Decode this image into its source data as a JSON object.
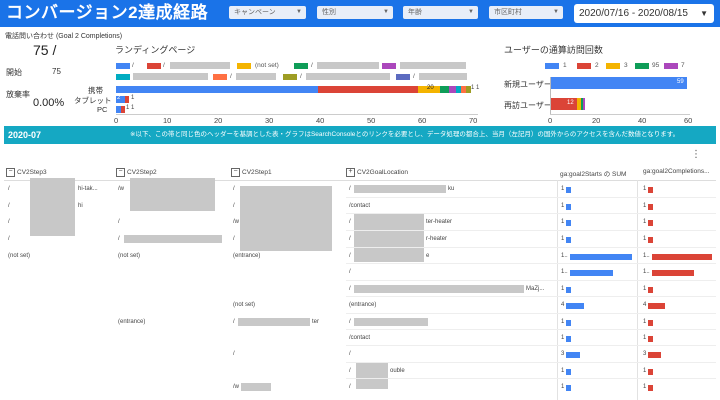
{
  "header": {
    "title": "コンバージョン2達成経路",
    "filters": [
      "キャンペーン",
      "性別",
      "年齢",
      "市区町村"
    ],
    "date_range": "2020/07/16 - 2020/08/15"
  },
  "scorecard": {
    "label": "電話問い合わせ (Goal 2 Completions)",
    "value": "75 /",
    "start_label": "開始",
    "start_value": "75",
    "abandon_label": "放棄率",
    "abandon_value": "0.00%"
  },
  "landing": {
    "title": "ランディングページ",
    "legend": [
      "/",
      "/",
      "(not set)",
      "/",
      "/",
      "/",
      "/",
      "/"
    ],
    "device_labels": [
      "携帯",
      "タブレット",
      "PC"
    ],
    "mobile_inline_labels": [
      "20",
      "1",
      "1"
    ],
    "tablet_inline_labels": [
      "2",
      "1"
    ],
    "pc_inline_labels": [
      "1",
      "1"
    ],
    "x_ticks": [
      "0",
      "10",
      "20",
      "30",
      "40",
      "50",
      "60",
      "70"
    ]
  },
  "visits": {
    "title": "ユーザーの通算訪問回数",
    "legend": [
      "1",
      "2",
      "3",
      "95",
      "7"
    ],
    "rows": [
      "新規ユーザー",
      "再訪ユーザー"
    ],
    "new_value": "59",
    "return_value": "12",
    "x_ticks": [
      "0",
      "20",
      "40",
      "60"
    ]
  },
  "banner": {
    "period": "2020-07",
    "note": "※以下、この帯と同じ色のヘッダーを基調とした表・グラフはSearchConsoleとのリンクを必要とし、データ処理の都合上、当月（左記月）の国外からのアクセスを含んだ数値となります。"
  },
  "table": {
    "headers": [
      "CV2Step3",
      "CV2Step2",
      "CV2Step1",
      "CV2GoalLocation",
      "ga:goal2Starts の SUM",
      "ga:goal2Completions..."
    ],
    "step3": [
      "/",
      "/",
      "/",
      "/",
      "(not set)"
    ],
    "step3_suffix": [
      "hi-tak...",
      "hi"
    ],
    "step2": [
      "/w",
      "/",
      "/",
      "/",
      "(not set)",
      "(entrance)"
    ],
    "step1": [
      "/",
      "/",
      "/w",
      "/",
      "(entrance)",
      "(not set)",
      "/",
      "/",
      "/w"
    ],
    "step1_suffix": [
      "ter"
    ],
    "goal": [
      "/",
      "/contact",
      "/",
      "/",
      "/",
      "/",
      "/",
      "(entrance)",
      "/",
      "/contact",
      "/",
      "/",
      "/"
    ],
    "goal_suffix": [
      "ku",
      "ter-heater",
      "r-heater",
      "e",
      "MaZj...",
      "ouble"
    ],
    "starts": [
      "1",
      "1",
      "1",
      "1",
      "1..",
      "1..",
      "1",
      "4",
      "1",
      "1",
      "3",
      "1",
      "1"
    ],
    "completions": [
      "1",
      "1",
      "1",
      "1",
      "1..",
      "1..",
      "1",
      "4",
      "1",
      "1",
      "3",
      "1",
      "1"
    ]
  },
  "colors": {
    "header_blue": "#1a73e8",
    "banner_teal": "#15a8c3",
    "bar_blue": "#4285f4",
    "bar_red": "#db4437"
  }
}
